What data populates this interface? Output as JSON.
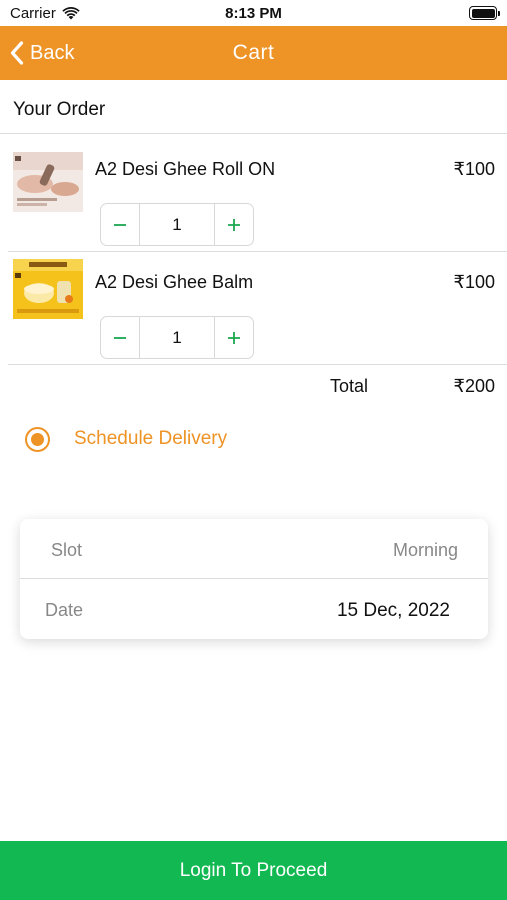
{
  "status_bar": {
    "carrier": "Carrier",
    "time": "8:13 PM",
    "icons": [
      "wifi-icon",
      "battery-icon"
    ]
  },
  "nav": {
    "back_label": "Back",
    "title": "Cart",
    "background_color": "#ee9325"
  },
  "order": {
    "section_title": "Your Order",
    "items": [
      {
        "name": "A2 Desi Ghee Roll ON",
        "price": "₹100",
        "quantity": "1",
        "image": "product-roll-on-image"
      },
      {
        "name": "A2 Desi Ghee Balm",
        "price": "₹100",
        "quantity": "1",
        "image": "product-balm-image"
      }
    ],
    "total_label": "Total",
    "total_value": "₹200"
  },
  "delivery": {
    "schedule_label": "Schedule Delivery",
    "selected": true,
    "accent_color": "#ee9325"
  },
  "slot_card": {
    "slot_label": "Slot",
    "slot_value": "Morning",
    "date_label": "Date",
    "date_value": "15 Dec, 2022"
  },
  "footer": {
    "proceed_label": "Login To Proceed",
    "button_color": "#12b851"
  }
}
